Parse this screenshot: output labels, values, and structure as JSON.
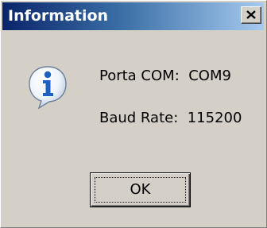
{
  "dialog": {
    "title": "Information",
    "icon": "info-icon",
    "close_glyph": "×",
    "lines": [
      "Porta COM:  COM9",
      "Baud Rate:  115200"
    ],
    "ok_label": "OK"
  },
  "colors": {
    "title_gradient_start": "#0a246a",
    "title_gradient_end": "#a6caf0",
    "face": "#d4d0c8",
    "icon_blue": "#1f5fbf"
  }
}
